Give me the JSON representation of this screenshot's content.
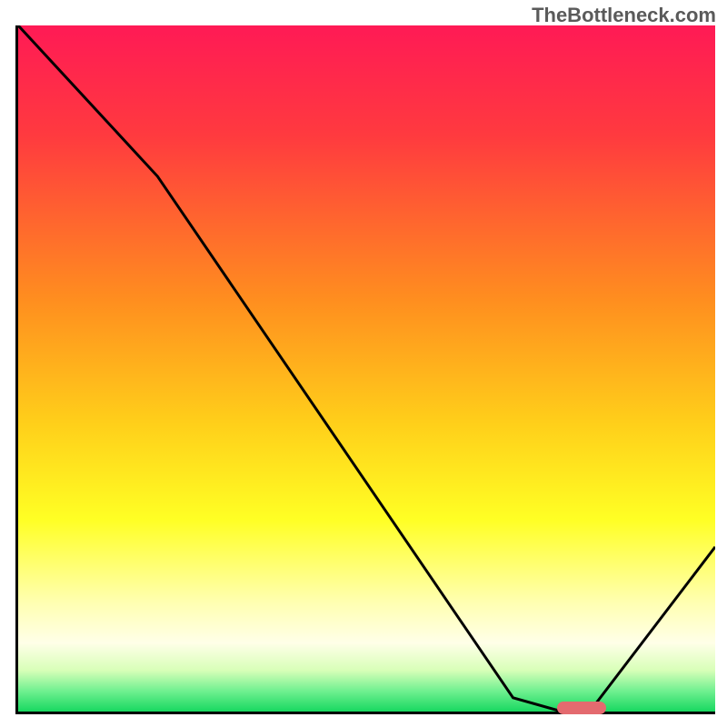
{
  "watermark": "TheBottleneck.com",
  "chart_data": {
    "type": "line",
    "title": "",
    "xlabel": "",
    "ylabel": "",
    "xlim": [
      0,
      100
    ],
    "ylim": [
      0,
      100
    ],
    "grid": false,
    "legend": false,
    "series": [
      {
        "name": "curve",
        "x": [
          0,
          20,
          71,
          78,
          82,
          100
        ],
        "values": [
          100,
          78,
          2,
          0,
          0,
          24
        ]
      }
    ],
    "marker": {
      "x_start": 77,
      "x_end": 84,
      "y": 0.5,
      "color": "#e46a6f"
    },
    "gradient_stops": [
      {
        "offset": 0,
        "color": "#ff1a55"
      },
      {
        "offset": 16,
        "color": "#ff3a3f"
      },
      {
        "offset": 40,
        "color": "#ff8e1f"
      },
      {
        "offset": 58,
        "color": "#ffcf1a"
      },
      {
        "offset": 72,
        "color": "#ffff24"
      },
      {
        "offset": 84,
        "color": "#ffffb0"
      },
      {
        "offset": 90,
        "color": "#ffffe8"
      },
      {
        "offset": 94,
        "color": "#d8ffb8"
      },
      {
        "offset": 97,
        "color": "#70f090"
      },
      {
        "offset": 100,
        "color": "#18d860"
      }
    ]
  }
}
